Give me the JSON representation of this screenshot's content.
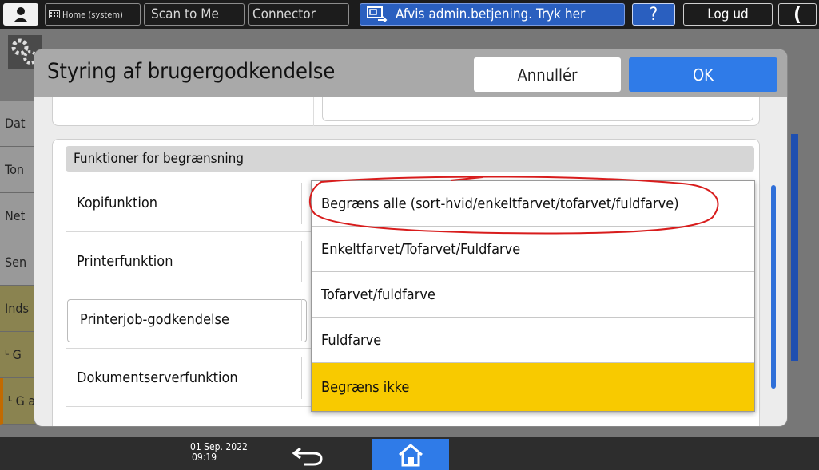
{
  "topbar": {
    "home_label": "Home (system)",
    "scan_label": "Scan to Me",
    "connector_label": "Connector",
    "admin_label": "Afvis admin.betjening. Tryk her",
    "help_label": "?",
    "logout_label": "Log ud",
    "moon_label": "("
  },
  "background": {
    "rows": [
      "Dat",
      "Ton",
      "Net",
      "Sen",
      "Inds",
      "ᴸ G",
      "ᴸ G a"
    ]
  },
  "modal": {
    "title": "Styring af brugergodkendelse",
    "cancel_label": "Annullér",
    "ok_label": "OK",
    "section_title": "Funktioner for begrænsning",
    "rows": [
      {
        "label": "Kopifunktion"
      },
      {
        "label": "Printerfunktion"
      },
      {
        "label": "Printerjob-godkendelse"
      },
      {
        "label": "Dokumentserverfunktion"
      }
    ]
  },
  "dropdown": {
    "options": [
      "Begræns alle (sort-hvid/enkeltfarvet/tofarvet/fuldfarve)",
      "Enkeltfarvet/Tofarvet/Fuldfarve",
      "Tofarvet/fuldfarve",
      "Fuldfarve",
      "Begræns ikke"
    ],
    "selected_index": 4
  },
  "bottombar": {
    "date": "01 Sep. 2022",
    "time": "09:19"
  },
  "colors": {
    "accent": "#2f7be8",
    "highlight": "#f8ca00",
    "annotation": "#d81c1c"
  }
}
